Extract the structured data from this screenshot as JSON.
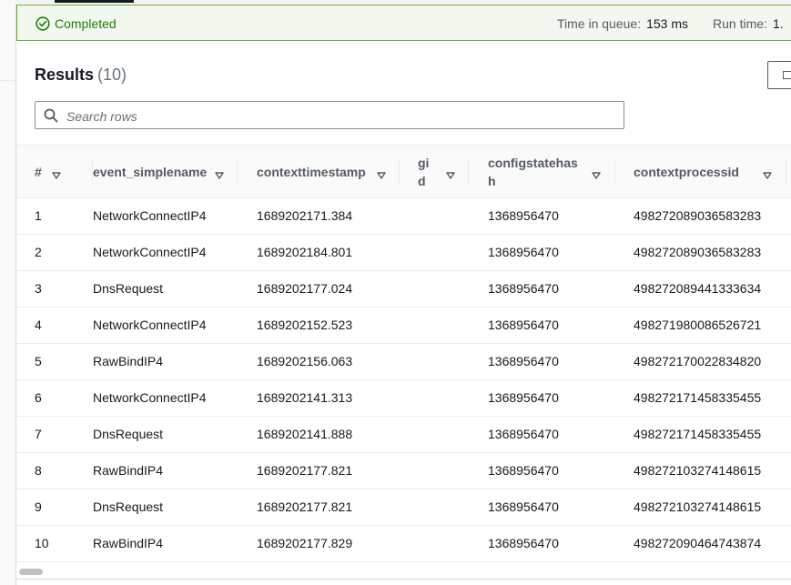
{
  "status": {
    "text": "Completed",
    "icon": "check-circle-icon",
    "color": "#1d8102",
    "queue_label": "Time in queue:",
    "queue_value": "153 ms",
    "runtime_label": "Run time:",
    "runtime_value": "1."
  },
  "results": {
    "title": "Results",
    "count": "(10)"
  },
  "search": {
    "placeholder": "Search rows",
    "value": ""
  },
  "table": {
    "headers": [
      "#",
      "event_simplename",
      "contexttimestamp",
      "gi\nd",
      "configstatehas\nh",
      "contextprocessid"
    ],
    "rows": [
      [
        "1",
        "NetworkConnectIP4",
        "1689202171.384",
        "",
        "1368956470",
        "498272089036583283"
      ],
      [
        "2",
        "NetworkConnectIP4",
        "1689202184.801",
        "",
        "1368956470",
        "498272089036583283"
      ],
      [
        "3",
        "DnsRequest",
        "1689202177.024",
        "",
        "1368956470",
        "498272089441333634"
      ],
      [
        "4",
        "NetworkConnectIP4",
        "1689202152.523",
        "",
        "1368956470",
        "498271980086526721"
      ],
      [
        "5",
        "RawBindIP4",
        "1689202156.063",
        "",
        "1368956470",
        "498272170022834820"
      ],
      [
        "6",
        "NetworkConnectIP4",
        "1689202141.313",
        "",
        "1368956470",
        "498272171458335455"
      ],
      [
        "7",
        "DnsRequest",
        "1689202141.888",
        "",
        "1368956470",
        "498272171458335455"
      ],
      [
        "8",
        "RawBindIP4",
        "1689202177.821",
        "",
        "1368956470",
        "498272103274148615"
      ],
      [
        "9",
        "DnsRequest",
        "1689202177.821",
        "",
        "1368956470",
        "498272103274148615"
      ],
      [
        "10",
        "RawBindIP4",
        "1689202177.829",
        "",
        "1368956470",
        "498272090464743874"
      ]
    ]
  }
}
